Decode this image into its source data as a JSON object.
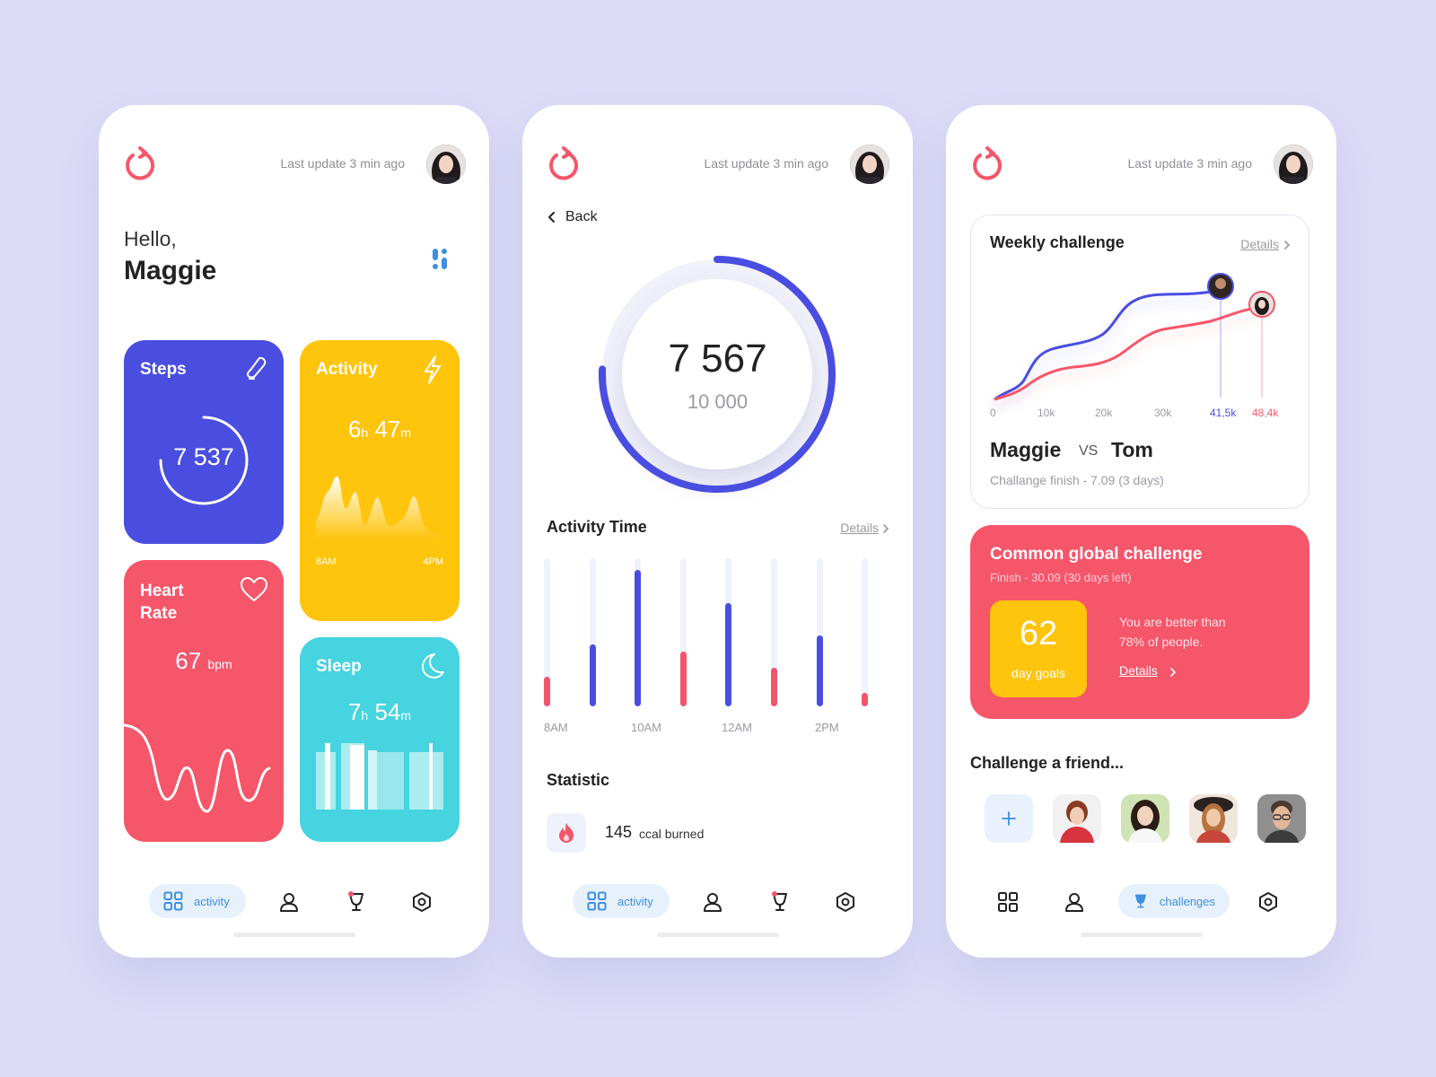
{
  "header": {
    "last_update": "Last update 3 min ago"
  },
  "screen1": {
    "greeting": "Hello,",
    "name": "Maggie",
    "steps": {
      "title": "Steps",
      "value": "7 537",
      "progress": 0.75
    },
    "activity": {
      "title": "Activity",
      "hours": "6",
      "h_unit": "h",
      "minutes": "47",
      "m_unit": "m",
      "start": "8AM",
      "end": "4PM"
    },
    "heart": {
      "title_line1": "Heart",
      "title_line2": "Rate",
      "value": "67",
      "unit": "bpm"
    },
    "sleep": {
      "title": "Sleep",
      "hours": "7",
      "h_unit": "h",
      "minutes": "54",
      "m_unit": "m"
    }
  },
  "screen2": {
    "back": "Back",
    "steps_value": "7 567",
    "steps_goal": "10 000",
    "steps_progress": 0.757,
    "activity_time_title": "Activity Time",
    "details": "Details",
    "bars": [
      {
        "level": 0.2,
        "color": "#f2556a"
      },
      {
        "level": 0.42,
        "color": "#4a4ee0"
      },
      {
        "level": 0.92,
        "color": "#4a4ee0"
      },
      {
        "level": 0.37,
        "color": "#f2556a"
      },
      {
        "level": 0.7,
        "color": "#4a4ee0"
      },
      {
        "level": 0.26,
        "color": "#f2556a"
      },
      {
        "level": 0.48,
        "color": "#4a4ee0"
      },
      {
        "level": 0.09,
        "color": "#f2556a"
      }
    ],
    "time_labels": [
      "8AM",
      "10AM",
      "12AM",
      "2PM"
    ],
    "statistic_title": "Statistic",
    "calories": "145",
    "calories_label": "ccal burned"
  },
  "screen3": {
    "weekly": {
      "title": "Weekly challenge",
      "details": "Details",
      "axis": [
        "0",
        "10k",
        "20k",
        "30k"
      ],
      "value_a": "41,5k",
      "value_b": "48,4k",
      "player_a": "Maggie",
      "vs": "VS",
      "player_b": "Tom",
      "finish": "Challange finish  - 7.09 (3 days)"
    },
    "global": {
      "title": "Common global challenge",
      "finish": "Finish - 30.09 (30 days left)",
      "days": "62",
      "days_label": "day goals",
      "better_line1": "You are better than",
      "better_line2": "78% of people.",
      "details": "Details"
    },
    "friends_title": "Challenge a friend..."
  },
  "nav": {
    "activity": "activity",
    "challenges": "challenges"
  },
  "colors": {
    "blue": "#4a4ee0",
    "yellow": "#ffc40c",
    "red": "#f6566a",
    "cyan": "#45d4e0",
    "accent": "#3e8fe0"
  }
}
